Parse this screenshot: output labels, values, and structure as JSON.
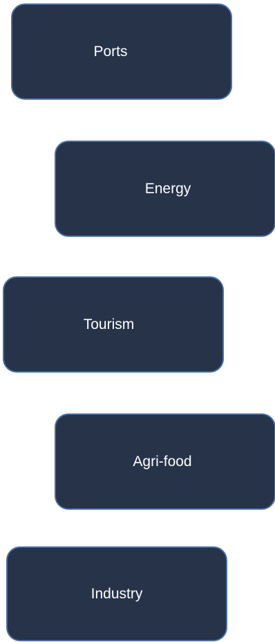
{
  "diagram": {
    "box_color": "#263349",
    "border_color": "#4a6fa5",
    "text_color": "#ffffff",
    "boxes": [
      {
        "label": "Ports"
      },
      {
        "label": "Energy"
      },
      {
        "label": "Tourism"
      },
      {
        "label": "Agri-food"
      },
      {
        "label": "Industry"
      }
    ]
  }
}
